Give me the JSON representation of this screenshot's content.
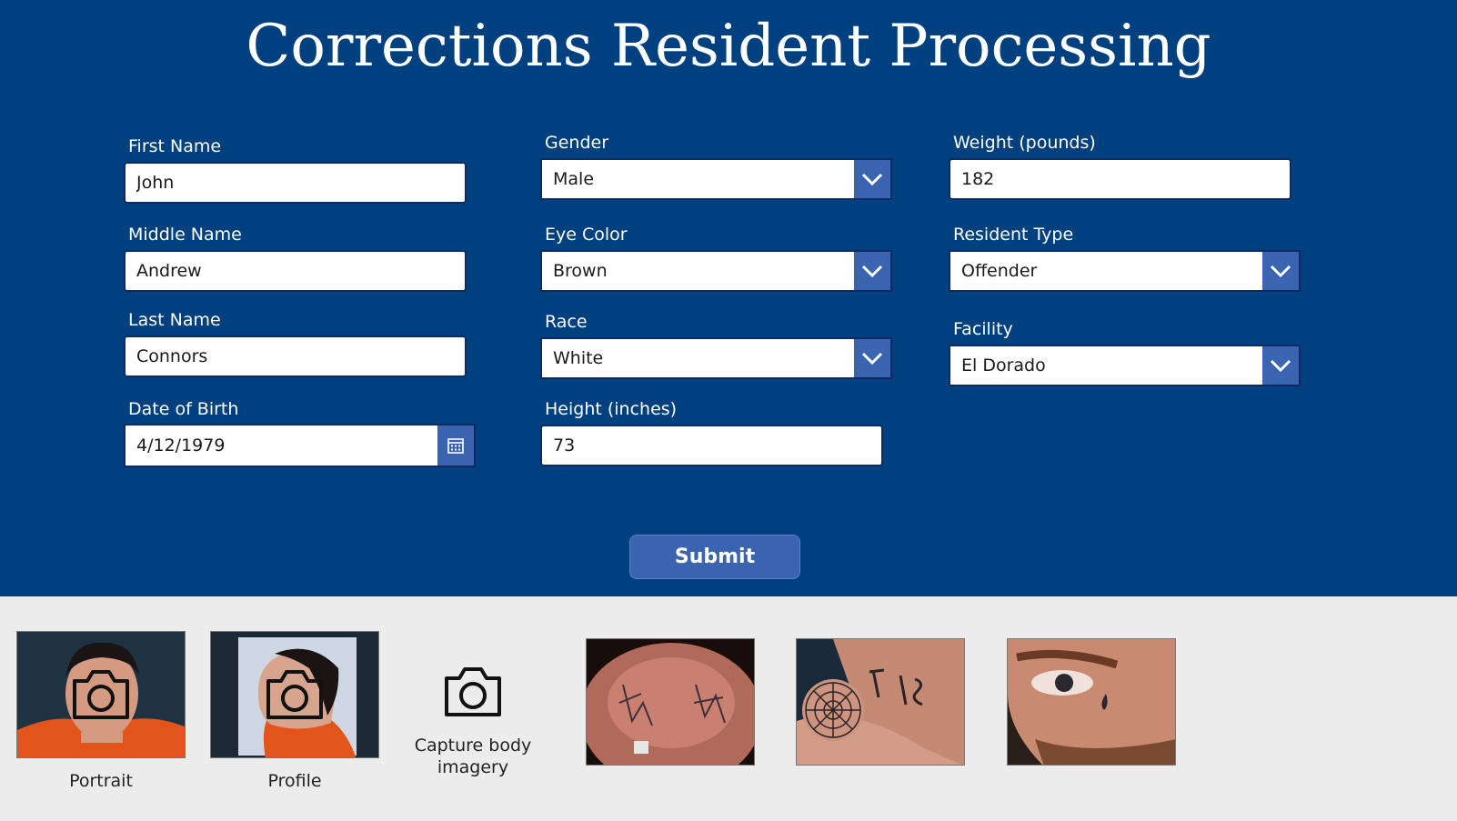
{
  "app": {
    "title": "Corrections Resident Processing"
  },
  "form": {
    "first_name": {
      "label": "First Name",
      "value": "John"
    },
    "middle_name": {
      "label": "Middle Name",
      "value": "Andrew"
    },
    "last_name": {
      "label": "Last Name",
      "value": "Connors"
    },
    "date_of_birth": {
      "label": "Date of Birth",
      "value": "4/12/1979"
    },
    "gender": {
      "label": "Gender",
      "value": "Male"
    },
    "eye_color": {
      "label": "Eye Color",
      "value": "Brown"
    },
    "race": {
      "label": "Race",
      "value": "White"
    },
    "height": {
      "label": "Height (inches)",
      "value": "73"
    },
    "weight": {
      "label": "Weight (pounds)",
      "value": "182"
    },
    "resident_type": {
      "label": "Resident Type",
      "value": "Offender"
    },
    "facility": {
      "label": "Facility",
      "value": "El Dorado"
    },
    "submit_label": "Submit"
  },
  "gallery": {
    "portrait_caption": "Portrait",
    "profile_caption": "Profile",
    "capture_caption": "Capture body imagery"
  },
  "colors": {
    "header_bg": "#00407f",
    "button_bg": "#3a64b0",
    "gallery_bg": "#ececec"
  }
}
